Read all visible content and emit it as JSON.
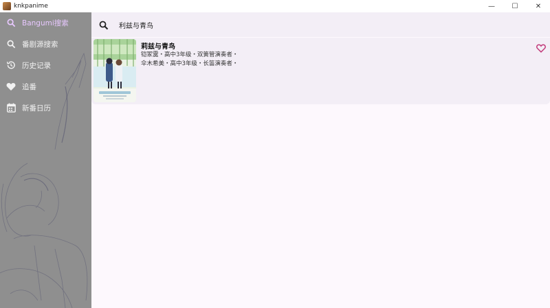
{
  "window": {
    "title": "knkpanime",
    "controls": {
      "minimize": "—",
      "maximize": "☐",
      "close": "✕"
    }
  },
  "sidebar": {
    "items": [
      {
        "label": "Bangumi搜索",
        "icon": "search-icon",
        "active": true
      },
      {
        "label": "番剧源搜索",
        "icon": "search-icon",
        "active": false
      },
      {
        "label": "历史记录",
        "icon": "history-icon",
        "active": false
      },
      {
        "label": "追番",
        "icon": "heart-icon",
        "active": false
      },
      {
        "label": "新番日历",
        "icon": "calendar-icon",
        "active": false
      }
    ]
  },
  "search": {
    "value": "利兹与青鸟",
    "placeholder": ""
  },
  "results": [
    {
      "title": "莉兹与青鸟",
      "description_lines": [
        "铠冢霙・高中3年级・双簧管演奏者・",
        "伞木希美・高中3年级・长笛演奏者・"
      ],
      "favorited": false
    }
  ],
  "colors": {
    "accent": "#c23b7a",
    "active_nav": "#e8c8ff",
    "sidebar_bg": "#8f8f8f",
    "main_bg": "#fdf8fd",
    "card_bg": "#f3eef6"
  }
}
